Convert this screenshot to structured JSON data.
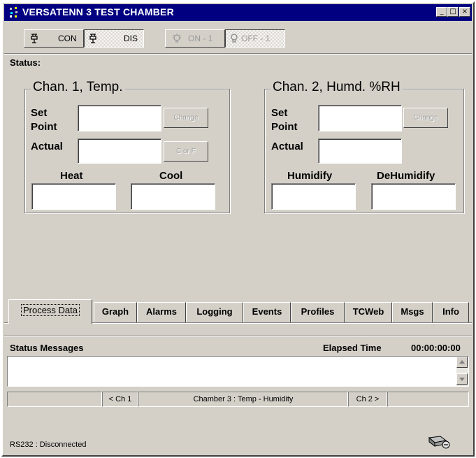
{
  "window": {
    "title": "VERSATENN 3 TEST CHAMBER",
    "minimize_glyph": "_",
    "maximize_glyph": "□",
    "close_glyph": "×"
  },
  "toolbar": {
    "connect_label": "CON",
    "disconnect_label": "DIS",
    "on_label": "ON - 1",
    "off_label": "OFF - 1"
  },
  "status_label": "Status:",
  "chan1": {
    "title": "Chan. 1, Temp.",
    "set_point_line1": "Set",
    "set_point_line2": "Point",
    "actual_label": "Actual",
    "change_button": "Change",
    "unit_button": "C or F",
    "left_output_label": "Heat",
    "right_output_label": "Cool"
  },
  "chan2": {
    "title": "Chan. 2, Humd. %RH",
    "set_point_line1": "Set",
    "set_point_line2": "Point",
    "actual_label": "Actual",
    "change_button": "Change",
    "left_output_label": "Humidify",
    "right_output_label": "DeHumidify"
  },
  "tabs": [
    "Process Data",
    "Graph",
    "Alarms",
    "Logging",
    "Events",
    "Profiles",
    "TCWeb",
    "Msgs",
    "Info"
  ],
  "status_panel": {
    "title": "Status Messages",
    "elapsed_label": "Elapsed Time",
    "elapsed_value": "00:00:00:00"
  },
  "nav_bar": {
    "prev_label": "< Ch 1",
    "chamber_label": "Chamber 3 : Temp - Humidity",
    "next_label": "Ch 2 >"
  },
  "connection_status": "RS232 : Disconnected",
  "icons": {
    "app": "app-icon",
    "connect": "plug-icon",
    "on": "bulb-on-icon",
    "off": "bulb-off-icon",
    "connection": "modem-icon"
  },
  "colors": {
    "titlebar": "#000080",
    "face": "#d4d0c8",
    "disabled_text": "#a0a0a0"
  }
}
